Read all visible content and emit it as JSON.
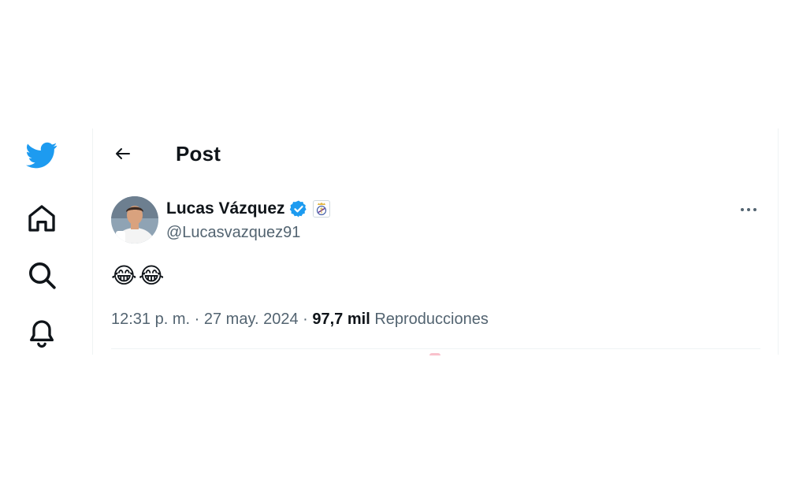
{
  "header": {
    "title": "Post"
  },
  "sidebar": {
    "items": [
      {
        "icon": "twitter-bird-logo",
        "color": "#1d9bf0"
      },
      {
        "icon": "home-icon"
      },
      {
        "icon": "search-icon"
      },
      {
        "icon": "bell-icon"
      }
    ]
  },
  "tweet": {
    "author": {
      "name": "Lucas Vázquez",
      "handle": "@Lucasvazquez91",
      "verified": true,
      "verified_color": "#1d9bf0"
    },
    "text": "😂😂",
    "time": "12:31 p. m.",
    "separator": "·",
    "date": "27 may. 2024",
    "views_count": "97,7 mil",
    "views_label": "Reproducciones"
  },
  "colors": {
    "text_primary": "#0f1419",
    "text_secondary": "#536471",
    "accent": "#1d9bf0",
    "border": "#eff3f4"
  }
}
